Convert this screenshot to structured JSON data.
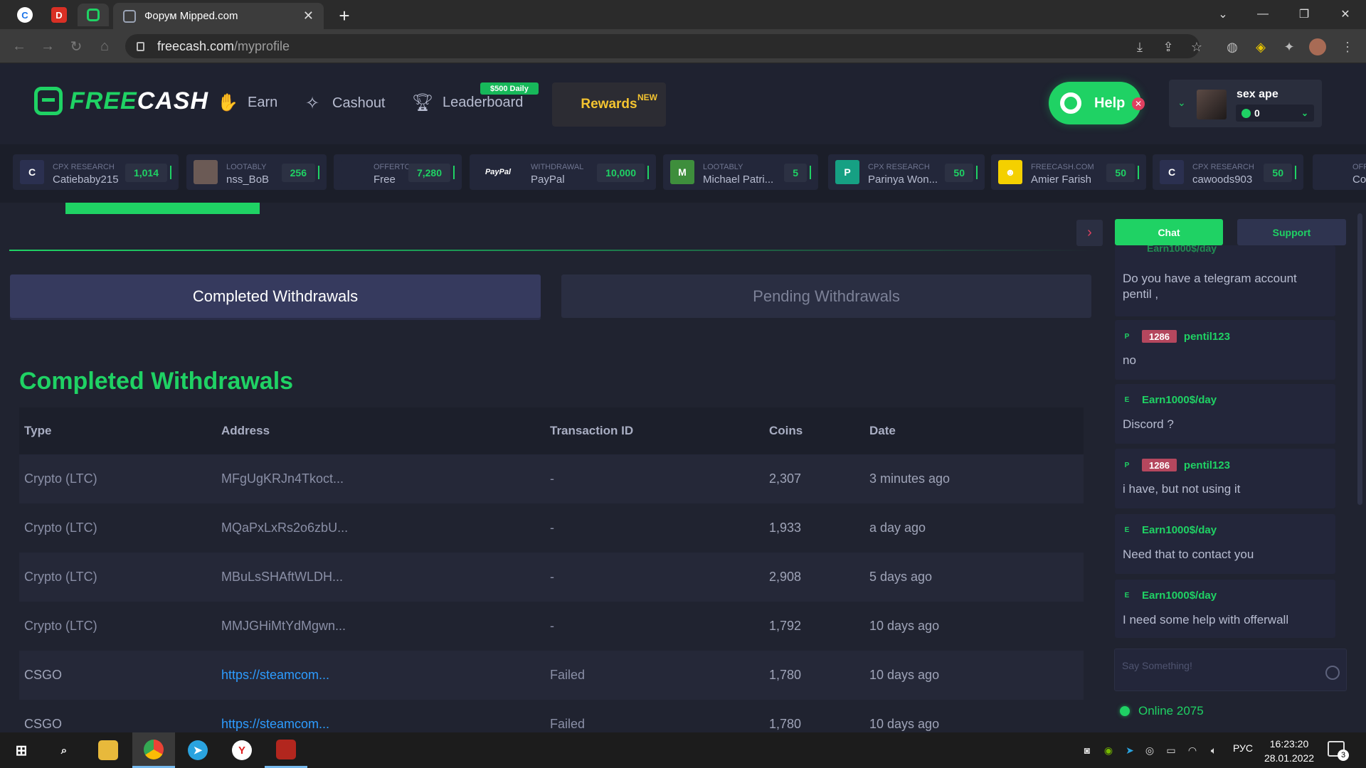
{
  "browser": {
    "active_tab_title": "Форум Mipped.com",
    "url_host": "freecash.com",
    "url_path": "/myprofile",
    "pinned_tabs": [
      "chrome-icon",
      "d-icon",
      "freecash-icon"
    ]
  },
  "header": {
    "logo_part1": "FREE",
    "logo_part2": "CASH",
    "nav": {
      "earn": "Earn",
      "cashout": "Cashout",
      "leaderboard": "Leaderboard"
    },
    "leaderboard_badge": "$500 Daily",
    "rewards": "Rewards",
    "rewards_badge": "NEW",
    "help": "Help",
    "user": {
      "name": "sex ape",
      "balance": "0"
    }
  },
  "ticker": [
    {
      "icon_letter": "C",
      "icon_color": "#2b3050",
      "source": "CPX RESEARCH",
      "user": "Catiebaby215",
      "amount": "1,014"
    },
    {
      "icon_letter": "",
      "icon_color": "#6b5a55",
      "source": "LOOTABLY",
      "user": "nss_BoB",
      "amount": "256"
    },
    {
      "icon_letter": "",
      "icon_color": "#23273a",
      "source": "OFFERTORO",
      "user": "Free",
      "amount": "7,280"
    },
    {
      "icon_letter": "PayPal",
      "icon_color": "#23273a",
      "source": "WITHDRAWAL",
      "user": "PayPal",
      "amount": "10,000"
    },
    {
      "icon_letter": "M",
      "icon_color": "#3e8e3c",
      "source": "LOOTABLY",
      "user": "Michael Patri...",
      "amount": "5"
    },
    {
      "icon_letter": "P",
      "icon_color": "#16a083",
      "source": "CPX RESEARCH",
      "user": "Parinya Won...",
      "amount": "50"
    },
    {
      "icon_letter": "☻",
      "icon_color": "#f4d000",
      "source": "FREECASH.COM",
      "user": "Amier Farish",
      "amount": "50"
    },
    {
      "icon_letter": "C",
      "icon_color": "#2b3050",
      "source": "CPX RESEARCH",
      "user": "cawoods903",
      "amount": "50"
    },
    {
      "icon_letter": "",
      "icon_color": "#23273a",
      "source": "OFFER",
      "user": "Cory",
      "amount": ""
    }
  ],
  "withdrawals": {
    "tab_completed": "Completed Withdrawals",
    "tab_pending": "Pending Withdrawals",
    "section_title": "Completed Withdrawals",
    "columns": [
      "Type",
      "Address",
      "Transaction ID",
      "Coins",
      "Date"
    ],
    "rows": [
      {
        "type": "Crypto (LTC)",
        "address": "MFgUgKRJn4Tkoct...",
        "txid": "-",
        "coins": "2,307",
        "date": "3 minutes ago"
      },
      {
        "type": "Crypto (LTC)",
        "address": "MQaPxLxRs2o6zbU...",
        "txid": "-",
        "coins": "1,933",
        "date": "a day ago"
      },
      {
        "type": "Crypto (LTC)",
        "address": "MBuLsSHAftWLDH...",
        "txid": "-",
        "coins": "2,908",
        "date": "5 days ago"
      },
      {
        "type": "Crypto (LTC)",
        "address": "MMJGHiMtYdMgwn...",
        "txid": "-",
        "coins": "1,792",
        "date": "10 days ago"
      },
      {
        "type": "CSGO",
        "address": "https://steamcom...",
        "txid": "Failed",
        "coins": "1,780",
        "date": "10 days ago"
      },
      {
        "type": "CSGO",
        "address": "https://steamcom...",
        "txid": "Failed",
        "coins": "1,780",
        "date": "10 days ago"
      }
    ]
  },
  "chat": {
    "tab_chat": "Chat",
    "tab_support": "Support",
    "partial_top_user": "Earn1000$/day",
    "messages": [
      {
        "level": "E",
        "rank": "",
        "user": "Earn1000$/day",
        "text": "Do you have a telegram account pentil ,"
      },
      {
        "level": "P",
        "rank": "1286",
        "user": "pentil123",
        "text": "no"
      },
      {
        "level": "E",
        "rank": "",
        "user": "Earn1000$/day",
        "text": "Discord ?"
      },
      {
        "level": "P",
        "rank": "1286",
        "user": "pentil123",
        "text": "i have, but not using it"
      },
      {
        "level": "E",
        "rank": "",
        "user": "Earn1000$/day",
        "text": "Need that to contact you"
      },
      {
        "level": "E",
        "rank": "",
        "user": "Earn1000$/day",
        "text": "I need some help with offerwall"
      }
    ],
    "input_placeholder": "Say Something!",
    "online": "Online 2075"
  },
  "taskbar": {
    "language": "РУС",
    "time": "16:23:20",
    "date": "28.01.2022",
    "notifications": "3"
  }
}
